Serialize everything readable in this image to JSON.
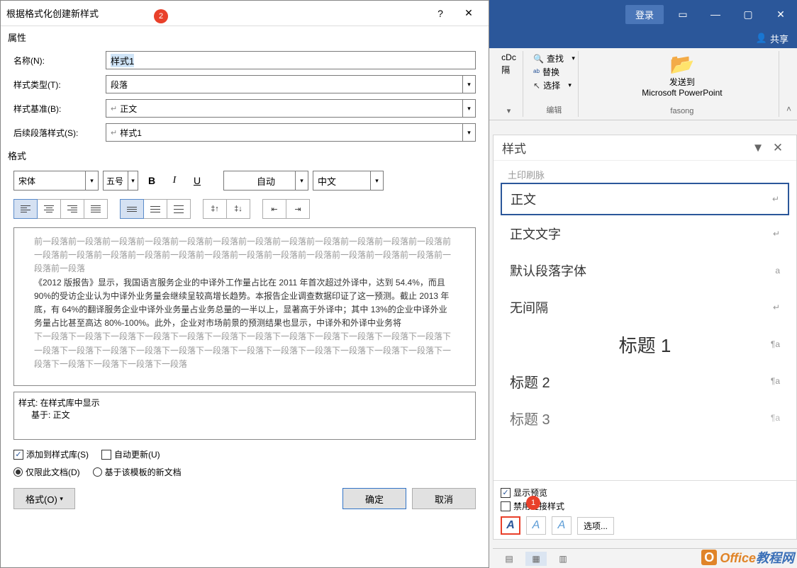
{
  "dialog": {
    "title": "根据格式化创建新样式",
    "badge2": "2",
    "help": "?",
    "close": "✕",
    "properties_label": "属性",
    "name_label": "名称(N):",
    "name_value": "样式1",
    "type_label": "样式类型(T):",
    "type_value": "段落",
    "based_label": "样式基准(B):",
    "based_value": "正文",
    "next_label": "后续段落样式(S):",
    "next_value": "样式1",
    "format_label": "格式",
    "font": "宋体",
    "size": "五号",
    "bold": "B",
    "italic": "I",
    "underline": "U",
    "color": "自动",
    "lang": "中文",
    "preview_before": "前一段落前一段落前一段落前一段落前一段落前一段落前一段落前一段落前一段落前一段落前一段落前一段落前一段落前一段落前一段落前一段落前一段落前一段落前一段落前一段落前一段落前一段落前一段落前一段落前一段落前一段落",
    "preview_body": "《2012 版报告》显示，我国语言服务企业的中译外工作量占比在 2011 年首次超过外译中，达到 54.4%，而且 90%的受访企业认为中译外业务量会继续呈较高增长趋势。本报告企业调查数据印证了这一预测。截止 2013 年底，有 64%的翻译服务企业中译外业务量占业务总量的一半以上，显著高于外译中；其中 13%的企业中译外业务量占比甚至高达 80%-100%。此外，企业对市场前景的预测结果也显示，中译外和外译中业务将",
    "preview_after": "下一段落下一段落下一段落下一段落下一段落下一段落下一段落下一段落下一段落下一段落下一段落下一段落下一段落下一段落下一段落下一段落下一段落下一段落下一段落下一段落下一段落下一段落下一段落下一段落下一段落下一段落下一段落下一段落下一段落",
    "desc_line1": "样式: 在样式库中显示",
    "desc_line2": "基于: 正文",
    "chk_add": "添加到样式库(S)",
    "chk_auto": "自动更新(U)",
    "radio_doc": "仅限此文档(D)",
    "radio_tpl": "基于该模板的新文档",
    "format_btn": "格式(O)",
    "ok": "确定",
    "cancel": "取消"
  },
  "word": {
    "login": "登录",
    "share": "共享",
    "cut_partial": "隔",
    "cdoc_partial": "cDc",
    "find": "查找",
    "replace": "替换",
    "select": "选择",
    "edit_label": "编辑",
    "sendto": "发送到",
    "sendto_target": "Microsoft PowerPoint",
    "fasong_label": "fasong"
  },
  "styles": {
    "pane_title": "样式",
    "truncated": "土印刷脉",
    "items": [
      {
        "name": "正文",
        "mark": "↵"
      },
      {
        "name": "正文文字",
        "mark": "↵"
      },
      {
        "name": "默认段落字体",
        "mark": "a"
      },
      {
        "name": "无间隔",
        "mark": "↵"
      },
      {
        "name": "标题 1",
        "mark": "¶a"
      },
      {
        "name": "标题 2",
        "mark": "¶a"
      },
      {
        "name": "标题 3",
        "mark": "¶a"
      }
    ],
    "show_preview": "显示预览",
    "disable_linked": "禁用链接样式",
    "options": "选项...",
    "badge1": "1"
  }
}
